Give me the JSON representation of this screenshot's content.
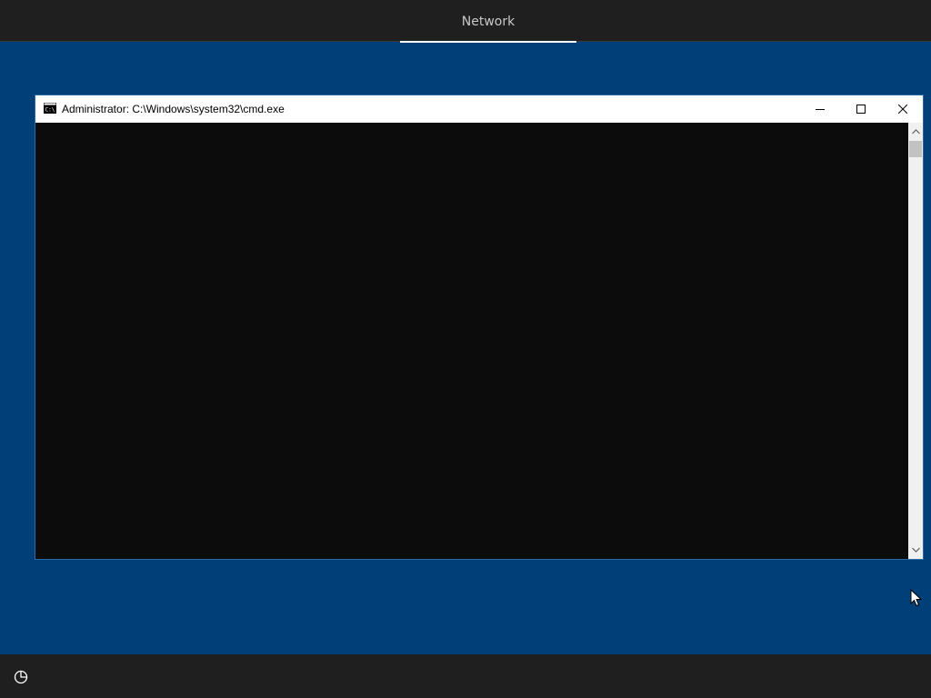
{
  "top_bar": {
    "active_tab": "Network"
  },
  "cmd_window": {
    "title": "Administrator: C:\\Windows\\system32\\cmd.exe",
    "icon": "cmd-icon",
    "controls": [
      "minimize-icon",
      "maximize-icon",
      "close-icon"
    ]
  },
  "bottom_bar": {
    "icon": "ease-of-access-icon"
  },
  "colors": {
    "desktop_background": "#003f78",
    "bars": "#1f1f1f",
    "console_background": "#0c0c0c"
  }
}
